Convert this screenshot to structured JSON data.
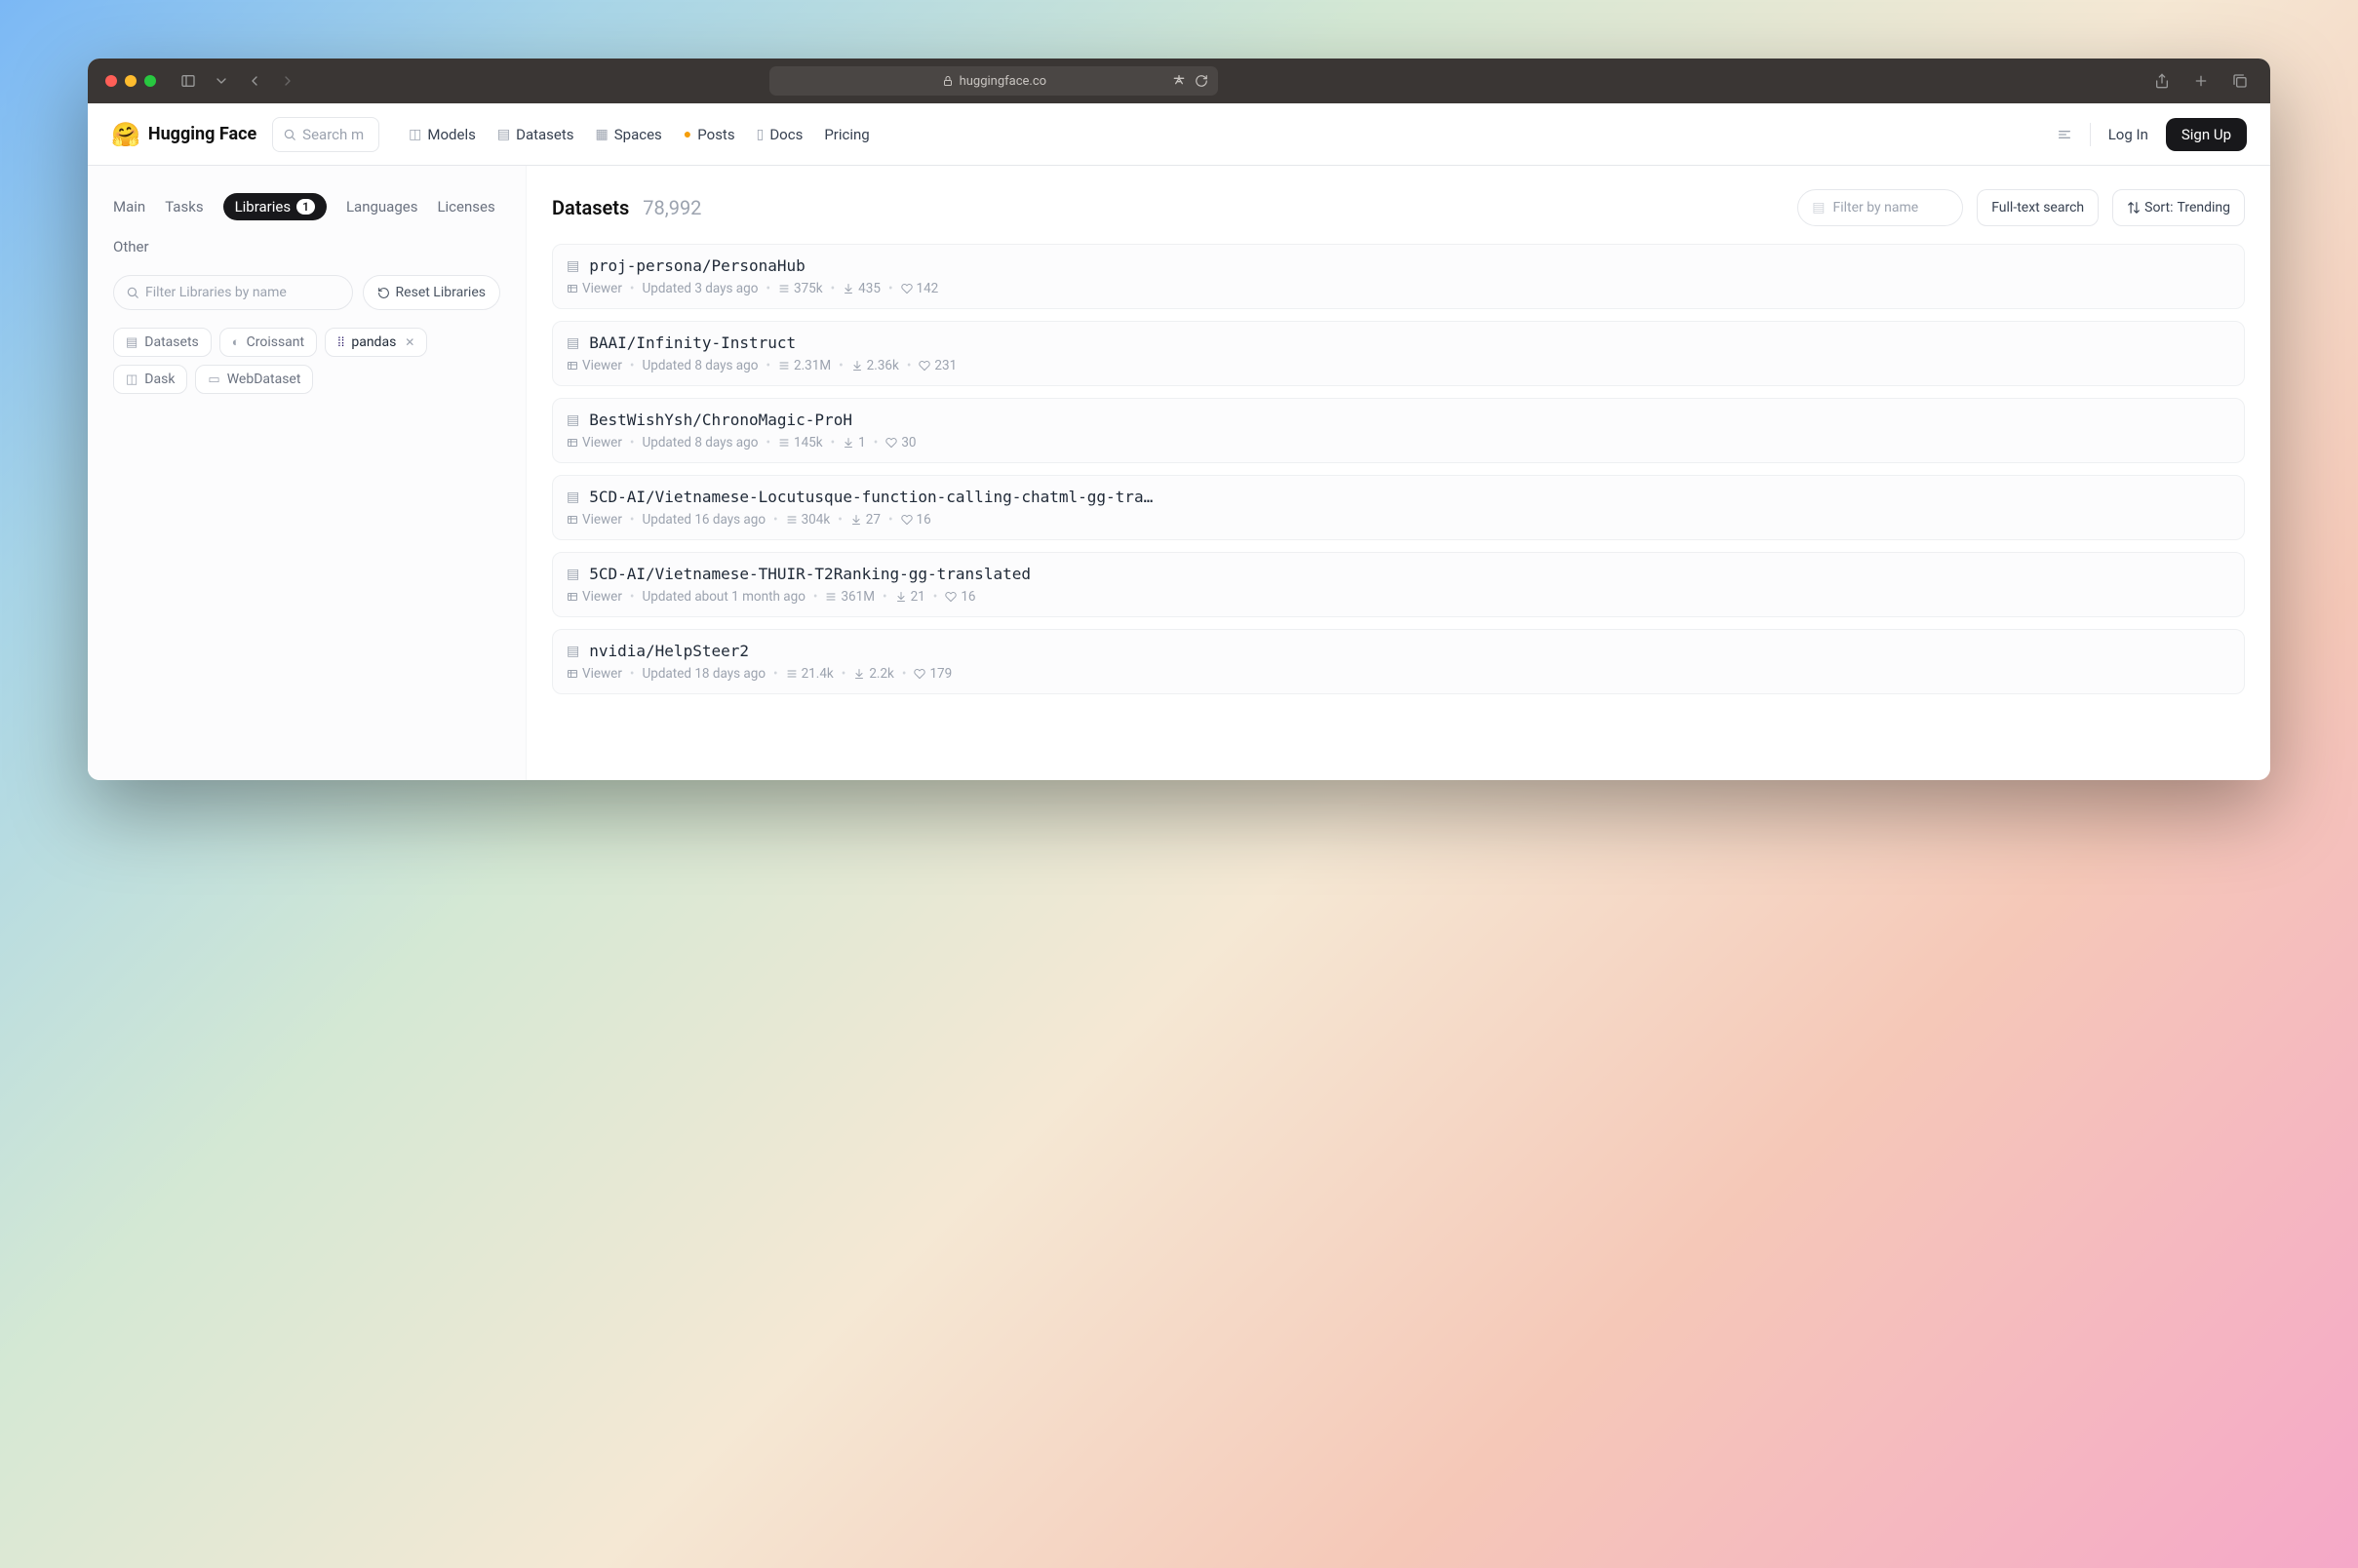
{
  "browser": {
    "url": "huggingface.co"
  },
  "header": {
    "brand": "Hugging Face",
    "search_placeholder": "Search m",
    "nav": {
      "models": "Models",
      "datasets": "Datasets",
      "spaces": "Spaces",
      "posts": "Posts",
      "docs": "Docs",
      "pricing": "Pricing"
    },
    "login": "Log In",
    "signup": "Sign Up"
  },
  "sidebar": {
    "tabs": {
      "main": "Main",
      "tasks": "Tasks",
      "libraries": "Libraries",
      "libraries_count": "1",
      "languages": "Languages",
      "licenses": "Licenses",
      "other": "Other"
    },
    "filter_placeholder": "Filter Libraries by name",
    "reset_label": "Reset Libraries",
    "tags": {
      "datasets": "Datasets",
      "croissant": "Croissant",
      "pandas": "pandas",
      "dask": "Dask",
      "webdataset": "WebDataset"
    }
  },
  "results": {
    "title": "Datasets",
    "count": "78,992",
    "filter_placeholder": "Filter by name",
    "fulltext_label": "Full-text search",
    "sort_label": "Sort:",
    "sort_value": "Trending",
    "items": [
      {
        "name": "proj-persona/PersonaHub",
        "viewer": "Viewer",
        "updated": "Updated 3 days ago",
        "rows": "375k",
        "downloads": "435",
        "likes": "142"
      },
      {
        "name": "BAAI/Infinity-Instruct",
        "viewer": "Viewer",
        "updated": "Updated 8 days ago",
        "rows": "2.31M",
        "downloads": "2.36k",
        "likes": "231"
      },
      {
        "name": "BestWishYsh/ChronoMagic-ProH",
        "viewer": "Viewer",
        "updated": "Updated 8 days ago",
        "rows": "145k",
        "downloads": "1",
        "likes": "30"
      },
      {
        "name": "5CD-AI/Vietnamese-Locutusque-function-calling-chatml-gg-tra…",
        "viewer": "Viewer",
        "updated": "Updated 16 days ago",
        "rows": "304k",
        "downloads": "27",
        "likes": "16"
      },
      {
        "name": "5CD-AI/Vietnamese-THUIR-T2Ranking-gg-translated",
        "viewer": "Viewer",
        "updated": "Updated about 1 month ago",
        "rows": "361M",
        "downloads": "21",
        "likes": "16"
      },
      {
        "name": "nvidia/HelpSteer2",
        "viewer": "Viewer",
        "updated": "Updated 18 days ago",
        "rows": "21.4k",
        "downloads": "2.2k",
        "likes": "179"
      }
    ]
  }
}
